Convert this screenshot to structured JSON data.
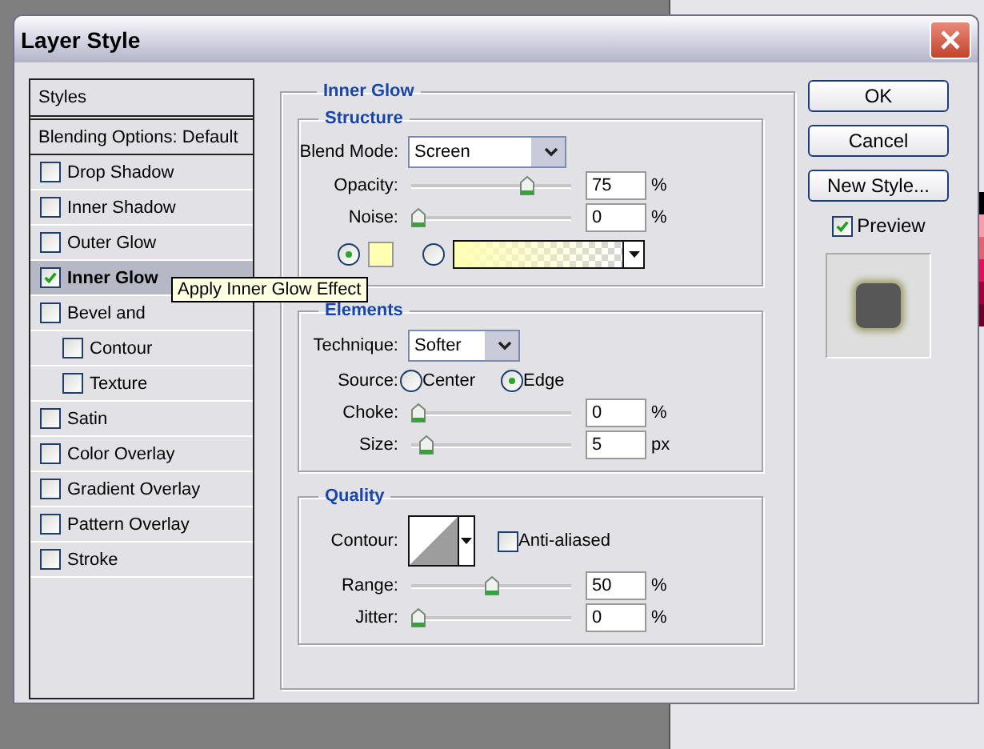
{
  "window": {
    "title": "Layer Style"
  },
  "styles_panel": {
    "header": "Styles",
    "items": [
      {
        "kind": "plain",
        "label": "Blending Options: Default",
        "selected": false
      },
      {
        "kind": "check",
        "label": "Drop Shadow",
        "checked": false,
        "selected": false
      },
      {
        "kind": "check",
        "label": "Inner Shadow",
        "checked": false,
        "selected": false
      },
      {
        "kind": "check",
        "label": "Outer Glow",
        "checked": false,
        "selected": false
      },
      {
        "kind": "check",
        "label": "Inner Glow",
        "checked": true,
        "selected": true
      },
      {
        "kind": "check",
        "label": "Bevel and",
        "checked": false,
        "selected": false,
        "children": [
          {
            "kind": "check",
            "label": "Contour",
            "checked": false,
            "selected": false
          },
          {
            "kind": "check",
            "label": "Texture",
            "checked": false,
            "selected": false
          }
        ]
      },
      {
        "kind": "check",
        "label": "Satin",
        "checked": false,
        "selected": false
      },
      {
        "kind": "check",
        "label": "Color Overlay",
        "checked": false,
        "selected": false
      },
      {
        "kind": "check",
        "label": "Gradient Overlay",
        "checked": false,
        "selected": false
      },
      {
        "kind": "check",
        "label": "Pattern Overlay",
        "checked": false,
        "selected": false
      },
      {
        "kind": "check",
        "label": "Stroke",
        "checked": false,
        "selected": false
      }
    ]
  },
  "tooltip": "Apply Inner Glow Effect",
  "inner_glow": {
    "title": "Inner Glow",
    "structure": {
      "title": "Structure",
      "blend_mode": {
        "label": "Blend Mode:",
        "value": "Screen"
      },
      "sliders": [
        {
          "label": "Opacity:",
          "level": 0.75,
          "value": "75",
          "unit": "%"
        },
        {
          "label": "Noise:",
          "level": 0,
          "value": "0",
          "unit": "%"
        }
      ],
      "fill_options": [
        {
          "kind": "color",
          "selected": true
        },
        {
          "kind": "gradient",
          "selected": false
        }
      ]
    },
    "elements": {
      "title": "Elements",
      "technique": {
        "label": "Technique:",
        "value": "Softer"
      },
      "source": {
        "label": "Source:",
        "options": [
          {
            "label": "Center",
            "selected": false
          },
          {
            "label": "Edge",
            "selected": true
          }
        ]
      },
      "sliders": [
        {
          "label": "Choke:",
          "level": 0,
          "value": "0",
          "unit": "%"
        },
        {
          "label": "Size:",
          "level": 0.05,
          "value": "5",
          "unit": "px"
        }
      ]
    },
    "quality": {
      "title": "Quality",
      "contour": {
        "label": "Contour:"
      },
      "anti_aliased": {
        "label": "Anti-aliased",
        "checked": false
      },
      "sliders": [
        {
          "label": "Range:",
          "level": 0.5,
          "value": "50",
          "unit": "%"
        },
        {
          "label": "Jitter:",
          "level": 0,
          "value": "0",
          "unit": "%"
        }
      ]
    }
  },
  "buttons": [
    "OK",
    "Cancel",
    "New Style..."
  ],
  "preview": {
    "label": "Preview",
    "checked": true
  }
}
